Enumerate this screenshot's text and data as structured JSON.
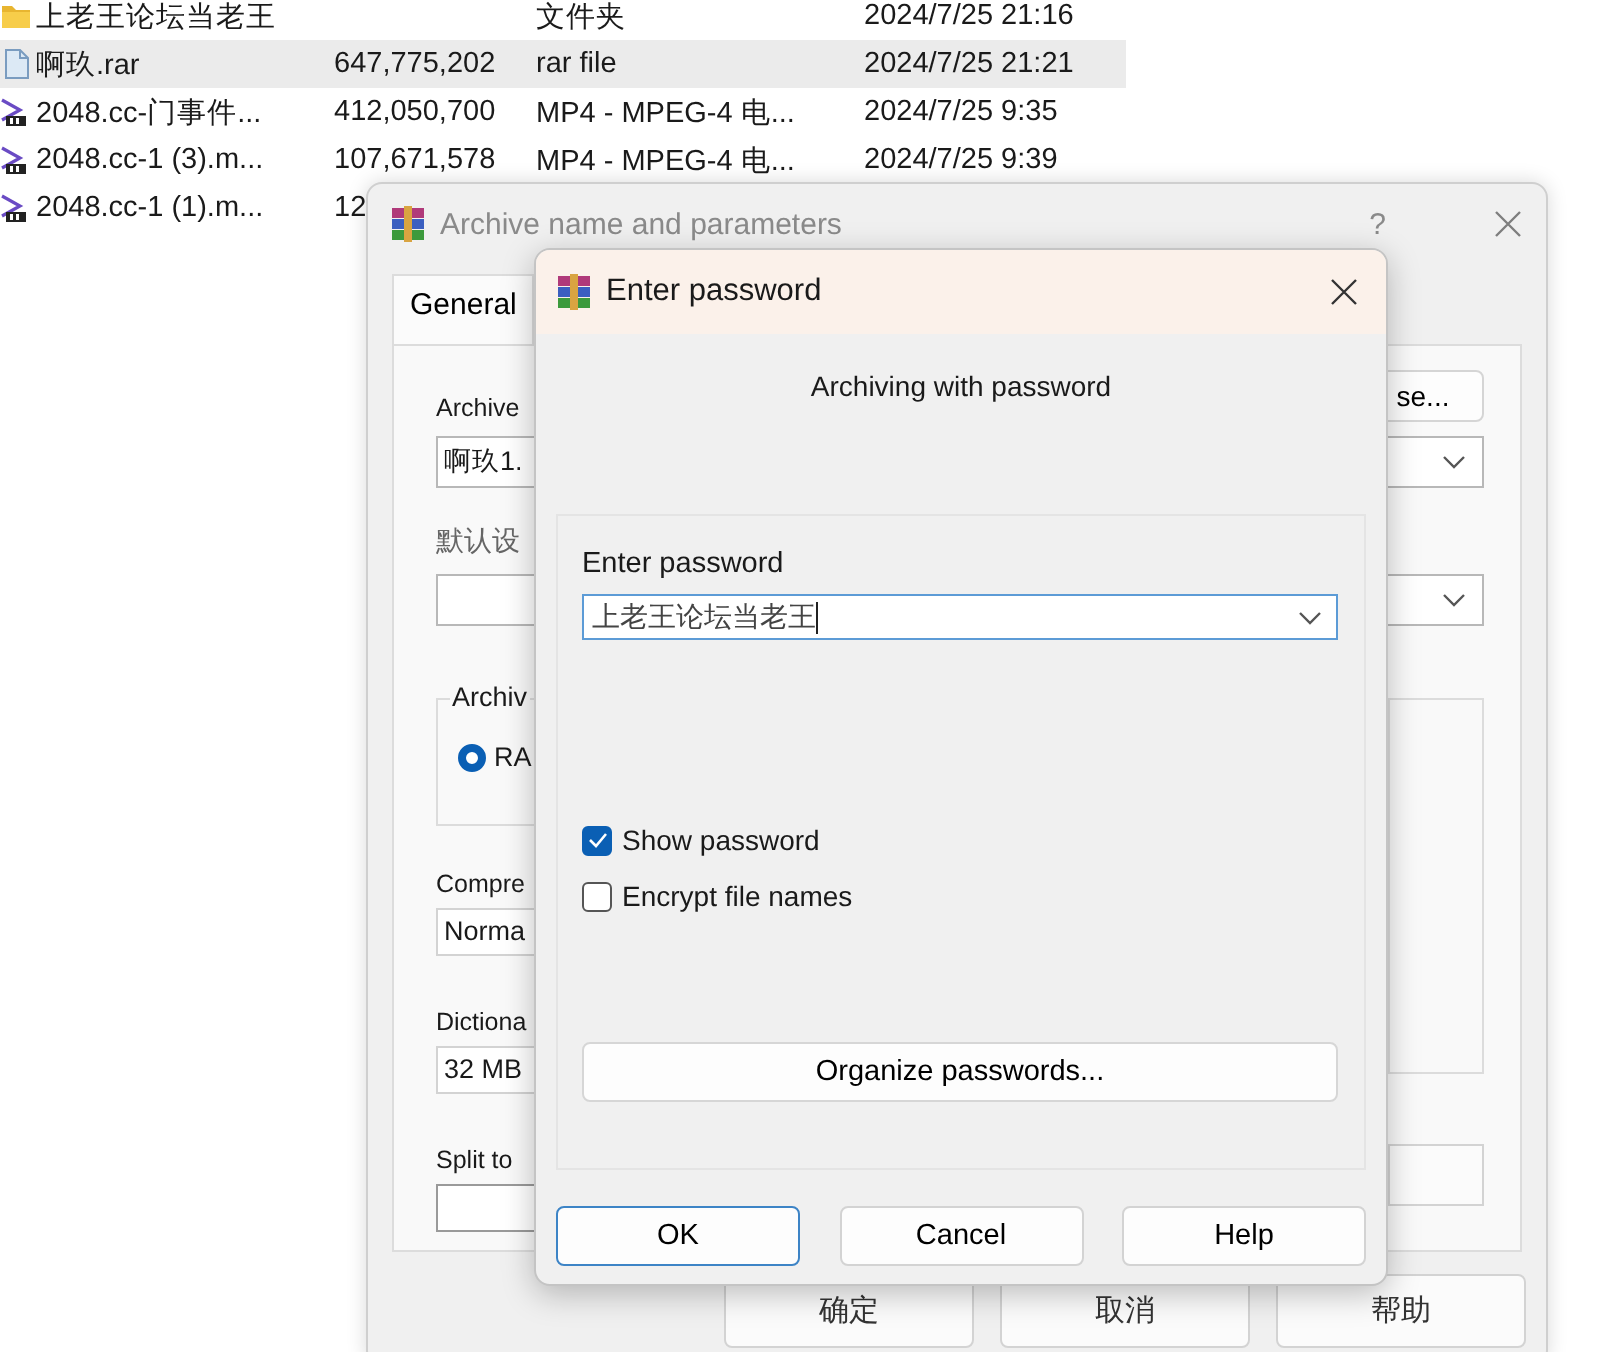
{
  "file_list": {
    "rows": [
      {
        "kind": "folder",
        "name": "上老王论坛当老王",
        "type": "文件夹",
        "modified": "2024/7/25 21:16",
        "selected": false
      },
      {
        "kind": "archive",
        "name": "啊玖.rar",
        "size": "647,775,202",
        "type": "rar file",
        "modified": "2024/7/25 21:21",
        "selected": true
      },
      {
        "kind": "video",
        "name": "2048.cc-门事件...",
        "size": "412,050,700",
        "type": "MP4 - MPEG-4 电...",
        "modified": "2024/7/25 9:35",
        "selected": false
      },
      {
        "kind": "video",
        "name": "2048.cc-1 (3).m...",
        "size": "107,671,578",
        "type": "MP4 - MPEG-4 电...",
        "modified": "2024/7/25 9:39",
        "selected": false
      },
      {
        "kind": "video",
        "name": "2048.cc-1 (1).m...",
        "size": "12",
        "selected": false
      }
    ]
  },
  "archive_dialog": {
    "title": "Archive name and parameters",
    "help": "?",
    "tabs": [
      {
        "label": "General",
        "selected": true
      }
    ],
    "archive_label": "Archive",
    "browse_button": "se...",
    "archive_name": "啊玖1.",
    "profile_label": "默认设",
    "format_group": "Archiv",
    "format_option": {
      "label": "RA",
      "selected": true
    },
    "compression_label": "Compre",
    "compression_value": "Norma",
    "dictionary_label": "Dictiona",
    "dictionary_value": "32 MB",
    "split_label": "Split to",
    "buttons": [
      "确定",
      "取消",
      "帮助"
    ]
  },
  "password_dialog": {
    "title": "Enter password",
    "subtitle": "Archiving with password",
    "password_label": "Enter password",
    "password_value": "上老王论坛当老王",
    "options": [
      {
        "label": "Show password",
        "checked": true
      },
      {
        "label": "Encrypt file names",
        "checked": false
      }
    ],
    "organize_button": "Organize passwords...",
    "buttons": [
      {
        "label": "OK",
        "default": true
      },
      {
        "label": "Cancel",
        "default": false
      },
      {
        "label": "Help",
        "default": false
      }
    ]
  }
}
